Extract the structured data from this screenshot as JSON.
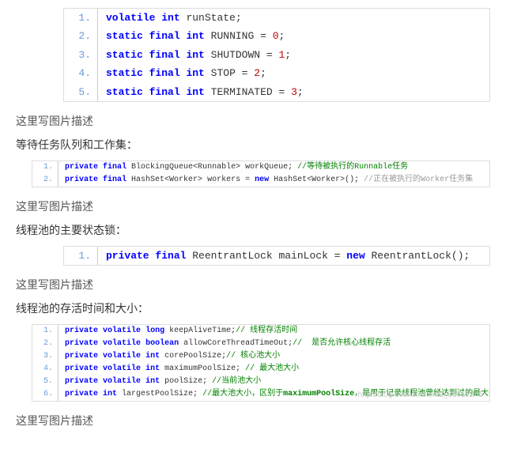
{
  "block1": {
    "lines": [
      {
        "n": "1.",
        "html": "<span class='kw'>volatile</span> <span class='kw'>int</span> runState;"
      },
      {
        "n": "2.",
        "html": "<span class='kw'>static</span> <span class='kw'>final</span> <span class='kw'>int</span> RUNNING = <span class='num'>0</span>;"
      },
      {
        "n": "3.",
        "html": "<span class='kw'>static</span> <span class='kw'>final</span> <span class='kw'>int</span> SHUTDOWN = <span class='num'>1</span>;"
      },
      {
        "n": "4.",
        "html": "<span class='kw'>static</span> <span class='kw'>final</span> <span class='kw'>int</span> STOP = <span class='num'>2</span>;"
      },
      {
        "n": "5.",
        "html": "<span class='kw'>static</span> <span class='kw'>final</span> <span class='kw'>int</span> TERMINATED = <span class='num'>3</span>;"
      }
    ]
  },
  "caption": "这里写图片描述",
  "section1": "等待任务队列和工作集：",
  "block2": {
    "lines": [
      {
        "n": "1.",
        "html": "<span class='kw'>private</span> <span class='kw'>final</span> BlockingQueue&lt;Runnable&gt; workQueue; <span class='cmt'>//等待被执行的Runnable任务</span>"
      },
      {
        "n": "2.",
        "html": "<span class='kw'>private</span> <span class='kw'>final</span> HashSet&lt;Worker&gt; workers = <span class='kw'>new</span> HashSet&lt;Worker&gt;(); <span class='gray-cmt'>//正在被执行的Worker任务集</span>"
      }
    ]
  },
  "section2": "线程池的主要状态锁：",
  "block3": {
    "lines": [
      {
        "n": "1.",
        "html": "<span class='kw'>private</span> <span class='kw'>final</span> ReentrantLock mainLock = <span class='kw'>new</span> ReentrantLock();"
      }
    ]
  },
  "section3": "线程池的存活时间和大小：",
  "block4": {
    "lines": [
      {
        "n": "1.",
        "html": "<span class='kw'>private</span> <span class='kw'>volatile</span> <span class='kw'>long</span> keepAliveTime;<span class='cmt'>// 线程存活时间</span>"
      },
      {
        "n": "2.",
        "html": "<span class='kw'>private</span> <span class='kw'>volatile</span> <span class='kw'>boolean</span> allowCoreThreadTimeOut;<span class='cmt'>//  是否允许核心线程存活</span>"
      },
      {
        "n": "3.",
        "html": "<span class='kw'>private</span> <span class='kw'>volatile</span> <span class='kw'>int</span> corePoolSize;<span class='cmt'>// 核心池大小</span>"
      },
      {
        "n": "4.",
        "html": "<span class='kw'>private</span> <span class='kw'>volatile</span> <span class='kw'>int</span> maximumPoolSize; <span class='cmt'>// 最大池大小</span>"
      },
      {
        "n": "5.",
        "html": "<span class='kw'>private</span> <span class='kw'>volatile</span> <span class='kw'>int</span> poolSize; <span class='cmt'>//当前池大小</span>"
      },
      {
        "n": "6.",
        "html": "<span class='kw'>private</span> <span class='kw'>int</span> largestPoolSize; <span class='cmt'>//最大池大小，区别于<b>maximumPoolSize</b>，是用于记录线程池曾经达到过的最大并发，理论上小于等于<b>maximumPoolSize</b>。</span>"
      }
    ],
    "watermark": "http://blog.csdn.net/sinat_35512245"
  }
}
